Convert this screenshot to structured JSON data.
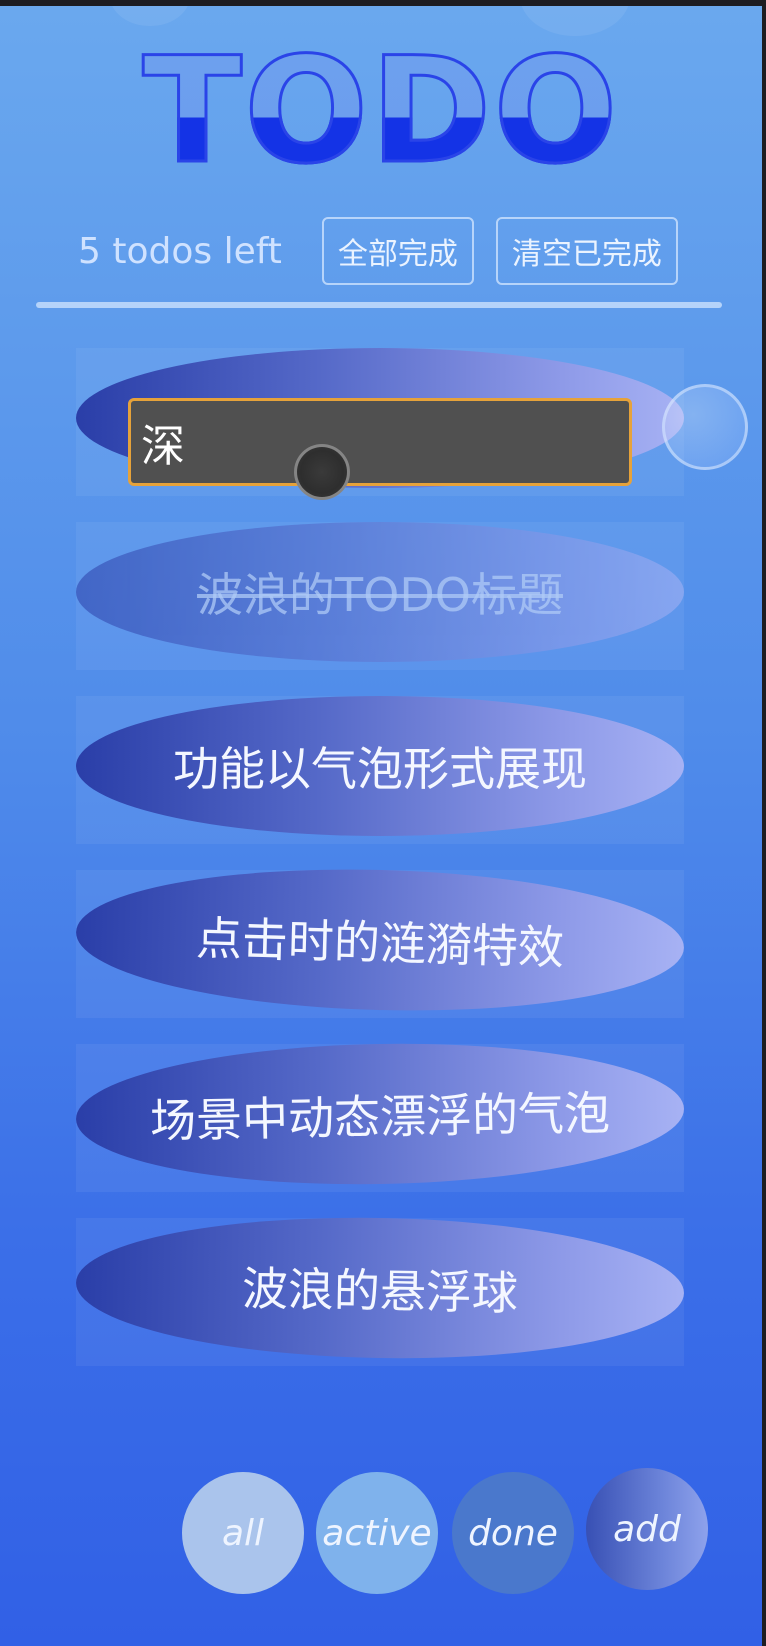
{
  "app": {
    "title": "TODO",
    "stats": {
      "todos_left": "5 todos left",
      "complete_all_label": "全部完成",
      "clear_completed_label": "清空已完成"
    },
    "editing": {
      "value": "深"
    },
    "todos": [
      {
        "text": "波浪的TODO标题",
        "completed": true
      },
      {
        "text": "功能以气泡形式展现",
        "completed": false
      },
      {
        "text": "点击时的涟漪特效",
        "completed": false
      },
      {
        "text": "场景中动态漂浮的气泡",
        "completed": false
      },
      {
        "text": "波浪的悬浮球",
        "completed": false
      }
    ],
    "filters": {
      "all": "all",
      "active": "active",
      "done": "done",
      "add": "add"
    }
  },
  "colors": {
    "background_top": "#6aa8ee",
    "background_bottom": "#3160e6",
    "title_fill": "#1433e6",
    "edit_border": "#e6a23a"
  }
}
